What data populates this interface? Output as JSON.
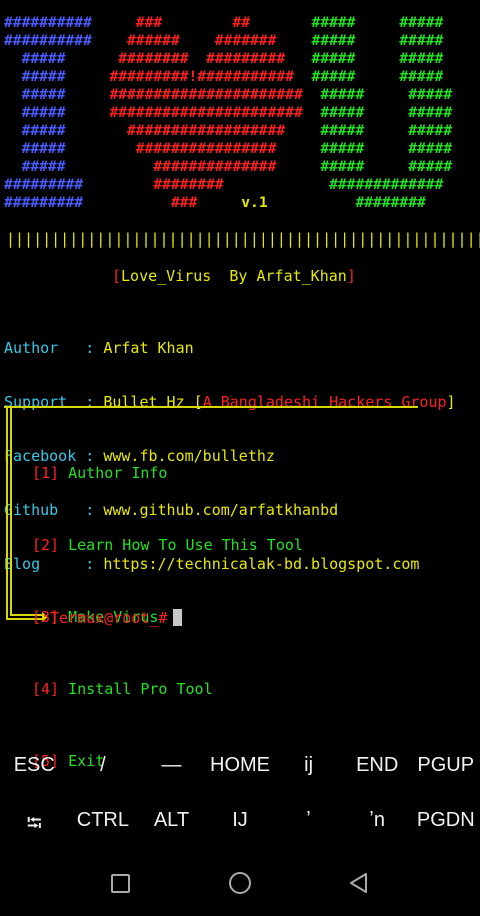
{
  "banner": {
    "rows": [
      {
        "c1": "##########",
        "c2": "     ###        ##       ",
        "c3": "#####     #####"
      },
      {
        "c1": "##########",
        "c2": "    ######    #######    ",
        "c3": "#####     #####"
      },
      {
        "c1": "  #####   ",
        "c2": "   ########  #########   ",
        "c3": "#####     #####"
      },
      {
        "c1": "  #####   ",
        "c2": "  #########!###########  ",
        "c3": "#####     #####"
      },
      {
        "c1": "  #####   ",
        "c2": "  ######################  ",
        "c3": "#####     #####"
      },
      {
        "c1": "  #####   ",
        "c2": "  ######################  ",
        "c3": "#####     #####"
      },
      {
        "c1": "  #####   ",
        "c2": "    ##################    ",
        "c3": "#####     #####"
      },
      {
        "c1": "  #####   ",
        "c2": "     ################     ",
        "c3": "#####     #####"
      },
      {
        "c1": "  #####   ",
        "c2": "       ##############     ",
        "c3": "#####     #####"
      },
      {
        "c1": "######### ",
        "c2": "       ########          ",
        "c3": "  ############# "
      },
      {
        "c1": "######### ",
        "c2": "         ###     ",
        "c4": "v.1",
        "c3": "          ######## "
      }
    ],
    "bars": "||||||||||||||||||||||||||||||||||||||||||||||||||||||"
  },
  "title": {
    "open": "[",
    "name": "Love_Virus  By Arfat_Khan",
    "close": "]"
  },
  "info": [
    {
      "label": "Author   :",
      "value": "Arfat Khan"
    },
    {
      "label": "Support  :",
      "value": "Bullet Hz [",
      "extra": "A Bangladeshi Hackers Group",
      "close": "]"
    },
    {
      "label": "Facebook :",
      "value": "www.fb.com/bullethz"
    },
    {
      "label": "Github   :",
      "value": "www.github.com/arfatkhanbd"
    },
    {
      "label": "Blog     :",
      "value": "https://technicalak-bd.blogspot.com"
    }
  ],
  "menu": [
    {
      "num": "[1]",
      "label": "Author Info"
    },
    {
      "num": "[2]",
      "label": "Learn How To Use This Tool"
    },
    {
      "num": "[3]",
      "label": "Make Virus"
    },
    {
      "num": "[4]",
      "label": "Install Pro Tool"
    },
    {
      "num": "[5]",
      "label": "Exit"
    }
  ],
  "prompt": "Termux@root_#",
  "keys_row1": [
    "ESC",
    "/",
    "—",
    "HOME",
    "ij",
    "END",
    "PGUP"
  ],
  "keys_row2": [
    "⭾",
    "CTRL",
    "ALT",
    "IJ",
    "ʼ",
    "ʼn",
    "PGDN"
  ],
  "colors": {
    "blue": "#4a5cff",
    "red": "#ff2020",
    "green": "#22e022",
    "yellow": "#e8e800",
    "cyan": "#36c8e8"
  }
}
